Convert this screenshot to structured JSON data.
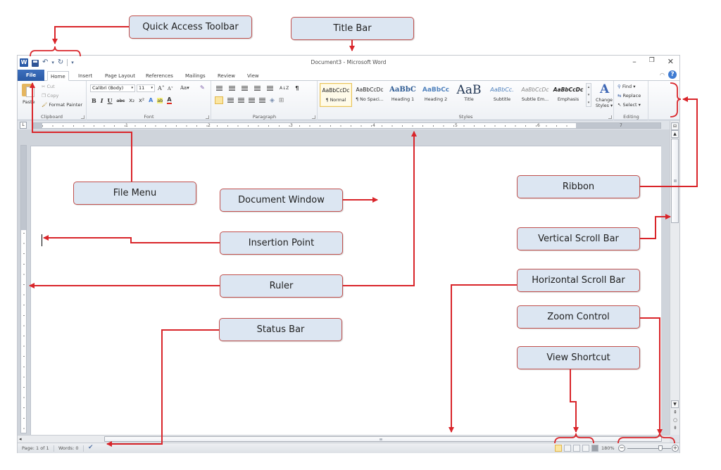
{
  "window": {
    "title": "Document3  -  Microsoft Word",
    "app_icon_label": "W",
    "controls": {
      "minimize": "–",
      "maximize": "❐",
      "close": "✕"
    }
  },
  "quick_access_toolbar": {
    "icons": [
      "save-icon",
      "undo-icon",
      "redo-icon",
      "customize-icon"
    ],
    "undo": "↶",
    "undo_drop": "▾",
    "redo": "↻",
    "customize": "▾"
  },
  "tabs": [
    {
      "label": "File"
    },
    {
      "label": "Home",
      "active": true
    },
    {
      "label": "Insert"
    },
    {
      "label": "Page Layout"
    },
    {
      "label": "References"
    },
    {
      "label": "Mailings"
    },
    {
      "label": "Review"
    },
    {
      "label": "View"
    }
  ],
  "help": {
    "minimize_ribbon": "◠",
    "help": "?"
  },
  "ribbon": {
    "clipboard": {
      "label": "Clipboard",
      "paste": "Paste",
      "cut": "Cut",
      "copy": "Copy",
      "format_painter": "Format Painter"
    },
    "font": {
      "label": "Font",
      "font_name": "Calibri (Body)",
      "font_size": "11",
      "grow": "A˄",
      "shrink": "A˅",
      "change_case": "Aa▾",
      "clear_format": "✎",
      "bold": "B",
      "italic": "I",
      "underline": "U",
      "strikethrough": "abc",
      "subscript": "x₂",
      "superscript": "x²",
      "text_effects": "A",
      "highlight": "ab",
      "font_color": "A"
    },
    "paragraph": {
      "label": "Paragraph",
      "sort": "A↓Z",
      "show_marks": "¶"
    },
    "styles": {
      "label": "Styles",
      "items": [
        {
          "sample": "AaBbCcDc",
          "name": "¶ Normal",
          "selected": true
        },
        {
          "sample": "AaBbCcDc",
          "name": "¶ No Spaci..."
        },
        {
          "sample": "AaBbC",
          "name": "Heading 1"
        },
        {
          "sample": "AaBbCc",
          "name": "Heading 2"
        },
        {
          "sample": "AaB",
          "name": "Title"
        },
        {
          "sample": "AaBbCc.",
          "name": "Subtitle"
        },
        {
          "sample": "AaBbCcDc",
          "name": "Subtle Em..."
        },
        {
          "sample": "AaBbCcDc",
          "name": "Emphasis"
        }
      ],
      "change_styles": "Change Styles ▾",
      "change_styles_icon": "A"
    },
    "editing": {
      "label": "Editing",
      "find": "Find ▾",
      "replace": "Replace",
      "select": "Select ▾"
    }
  },
  "ruler": {
    "tab_selector": "L",
    "numbers": [
      "1",
      "2",
      "3",
      "4",
      "5",
      "6",
      "7"
    ]
  },
  "scrollbar": {
    "up": "▲",
    "down": "▼",
    "prev_page": "⇞",
    "browse": "○",
    "next_page": "⇟",
    "left": "◂"
  },
  "statusbar": {
    "page": "Page: 1 of 1",
    "words": "Words: 0",
    "proofing_icon": "✔",
    "zoom": "180%",
    "zoom_out": "−",
    "zoom_in": "+",
    "zoom_level_fraction": 0.75
  },
  "callouts": {
    "quick_access_toolbar": "Quick Access Toolbar",
    "title_bar": "Title Bar",
    "file_menu": "File Menu",
    "document_window": "Document Window",
    "ribbon": "Ribbon",
    "insertion_point": "Insertion Point",
    "vertical_scroll_bar": "Vertical Scroll Bar",
    "ruler": "Ruler",
    "horizontal_scroll_bar": "Horizontal Scroll Bar",
    "status_bar": "Status Bar",
    "zoom_control": "Zoom Control",
    "view_shortcut": "View Shortcut"
  },
  "accent_colors": {
    "callout_border": "#c0504d",
    "callout_fill": "#dce6f2",
    "arrow": "#d9252a",
    "file_tab": "#2b579a"
  }
}
